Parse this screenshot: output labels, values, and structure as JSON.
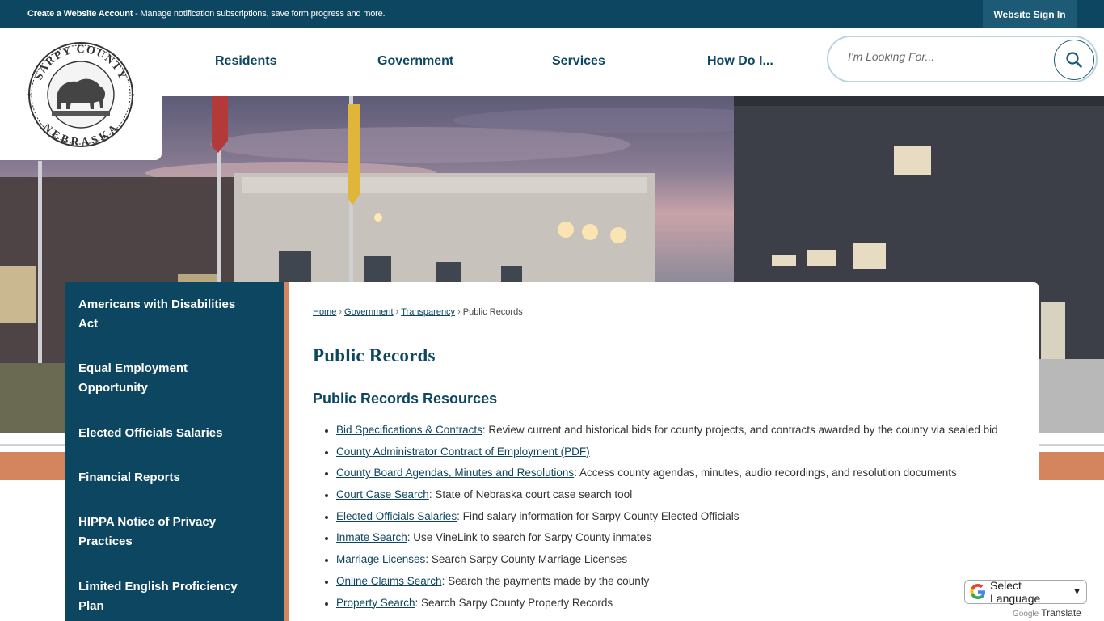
{
  "topbar": {
    "account_link": "Create a Website Account",
    "account_desc": " - Manage notification subscriptions, save form progress and more.",
    "signin": "Website Sign In"
  },
  "logo": {
    "alt": "Sarpy County Nebraska seal",
    "top_text": "SARPY COUNTY",
    "bottom_text": "NEBRASKA"
  },
  "nav": {
    "items": [
      {
        "label": "Residents"
      },
      {
        "label": "Government"
      },
      {
        "label": "Services"
      },
      {
        "label": "How Do I..."
      }
    ]
  },
  "search": {
    "placeholder": "I'm Looking For..."
  },
  "sidebar": {
    "items": [
      {
        "line1": "Americans with Disabilities",
        "line2": "Act"
      },
      {
        "line1": "Equal Employment",
        "line2": "Opportunity"
      },
      {
        "line1": "Elected Officials Salaries",
        "line2": ""
      },
      {
        "line1": "Financial Reports",
        "line2": ""
      },
      {
        "line1": "HIPPA Notice of Privacy",
        "line2": "Practices"
      },
      {
        "line1": "Limited English Proficiency",
        "line2": "Plan"
      }
    ]
  },
  "breadcrumb": {
    "home": "Home",
    "government": "Government",
    "transparency": "Transparency",
    "current": "Public Records"
  },
  "page": {
    "title": "Public Records",
    "subheading": "Public Records Resources"
  },
  "resources": [
    {
      "link": "Bid Specifications & Contracts",
      "desc": ": Review current and historical bids for county projects, and contracts awarded by the county via sealed bid"
    },
    {
      "link": "County Administrator Contract of Employment (PDF)",
      "desc": ""
    },
    {
      "link": "County Board Agendas, Minutes and Resolutions",
      "desc": ": Access county agendas, minutes, audio recordings, and resolution documents"
    },
    {
      "link": "Court Case Search",
      "desc": ": State of Nebraska court case search tool"
    },
    {
      "link": "Elected Officials Salaries",
      "desc": ": Find salary information for Sarpy County Elected Officials"
    },
    {
      "link": "Inmate Search",
      "desc": ": Use VineLink to search for Sarpy County inmates"
    },
    {
      "link": "Marriage Licenses",
      "desc": ": Search Sarpy County Marriage Licenses"
    },
    {
      "link": "Online Claims Search",
      "desc": ": Search the payments made by the county"
    },
    {
      "link": "Property Search",
      "desc": ": Search Sarpy County Property Records"
    }
  ],
  "translate": {
    "select_label": "Select Language",
    "powered_by": "Google",
    "translate_word": "Translate"
  },
  "colors": {
    "primary": "#0d4660",
    "accent": "#d5855d"
  }
}
